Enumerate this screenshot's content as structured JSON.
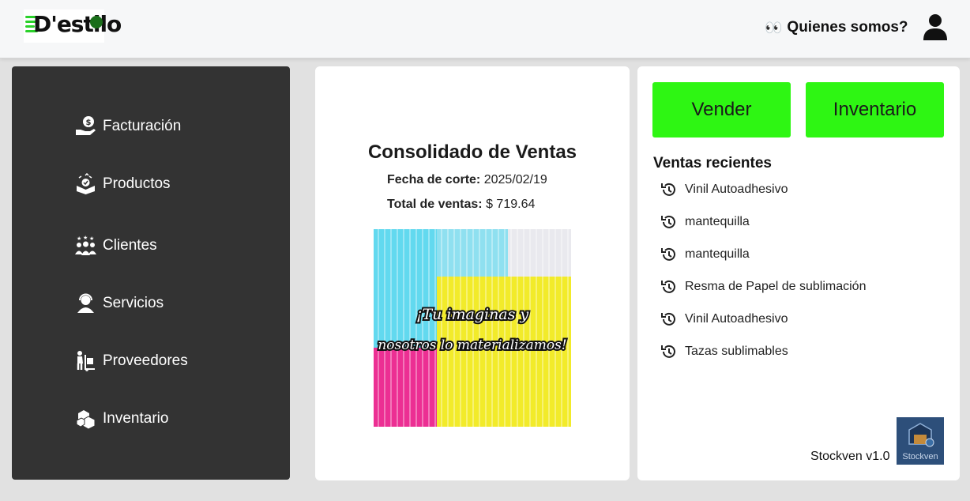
{
  "header": {
    "logo_text": "D'estilo",
    "about_label": "Quienes somos?"
  },
  "sidebar": {
    "items": [
      {
        "label": "Facturación",
        "icon": "invoice-money-icon"
      },
      {
        "label": "Productos",
        "icon": "product-box-icon"
      },
      {
        "label": "Clientes",
        "icon": "clients-group-icon"
      },
      {
        "label": "Servicios",
        "icon": "support-agent-icon"
      },
      {
        "label": "Proveedores",
        "icon": "supplier-dolly-icon"
      },
      {
        "label": "Inventario",
        "icon": "inventory-boxes-icon"
      }
    ]
  },
  "summary": {
    "title": "Consolidado de Ventas",
    "cut_date_label": "Fecha de corte:",
    "cut_date_value": "2025/02/19",
    "total_label": "Total de ventas:",
    "total_value": "$ 719.64",
    "promo_line1": "¡Tu imaginas y",
    "promo_line2": "nosotros lo materializamos!"
  },
  "actions": {
    "sell_label": "Vender",
    "inventory_label": "Inventario"
  },
  "recent": {
    "title": "Ventas recientes",
    "items": [
      "Vinil Autoadhesivo",
      "mantequilla",
      "mantequilla",
      "Resma de Papel de sublimación",
      "Vinil Autoadhesivo",
      "Tazas sublimables"
    ]
  },
  "footer": {
    "version": "Stockven v1.0",
    "app_logo_text": "Stockven"
  },
  "colors": {
    "accent_green": "#2ef613",
    "sidebar_bg": "#333333",
    "page_bg": "#e1e1e1"
  }
}
